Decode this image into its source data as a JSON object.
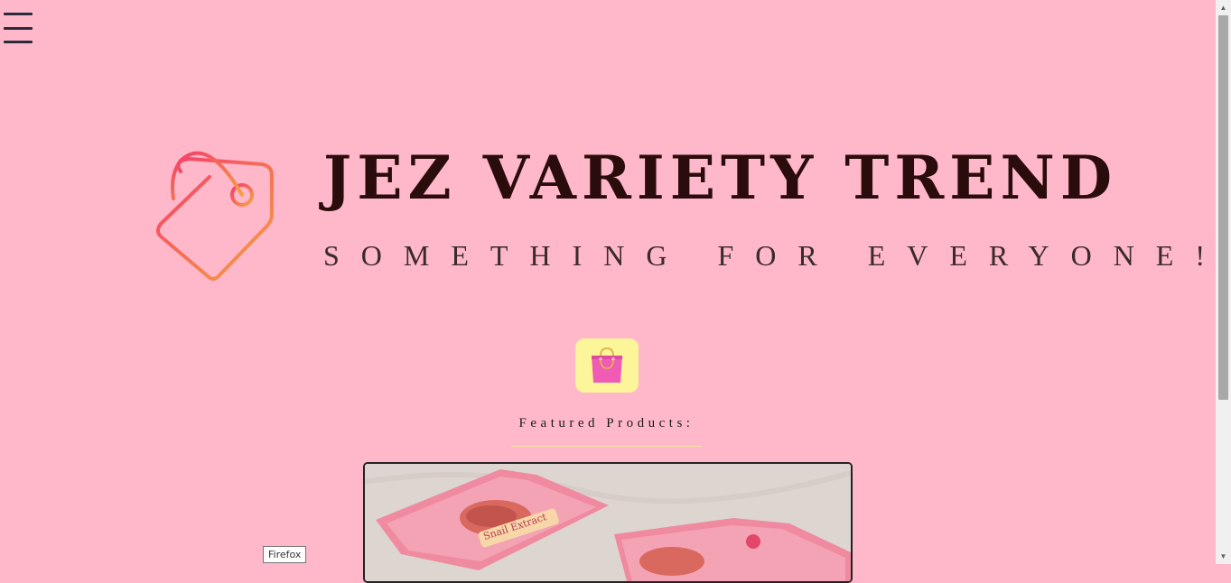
{
  "nav": {
    "menu_icon": "hamburger-icon"
  },
  "brand": {
    "name": "JEZ VARIETY TREND",
    "tagline": "SOMETHING FOR EVERYONE!",
    "logo_icon": "price-tag-icon",
    "colors": {
      "tag_gradient_start": "#f43a6e",
      "tag_gradient_end": "#f6a441",
      "title": "#2b0c0c"
    }
  },
  "shop": {
    "bag_icon": "shopping-bag-icon",
    "button_bg": "#fdf59a"
  },
  "featured": {
    "title": "Featured Products:",
    "products": [
      {
        "image": "snail-extract-mask-packets"
      }
    ]
  },
  "tooltip": {
    "text": "Firefox"
  },
  "theme": {
    "background": "#ffb8c9"
  }
}
